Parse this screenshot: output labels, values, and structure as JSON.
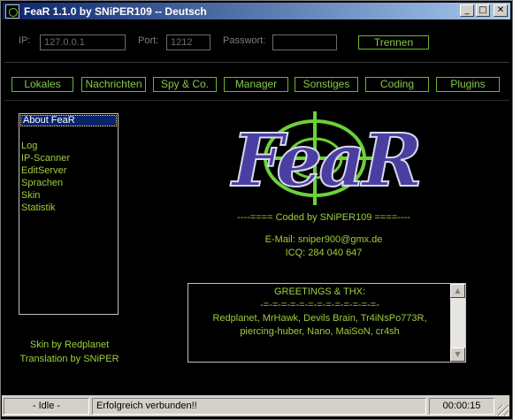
{
  "window": {
    "title": "FeaR 1.1.0 by SNiPER109 -- Deutsch",
    "buttons": {
      "minimize": "_",
      "maximize": "□",
      "close": "✕"
    }
  },
  "connection": {
    "ip_label": "IP:",
    "ip_value": "127.0.0.1",
    "port_label": "Port:",
    "port_value": "1212",
    "password_label": "Passwort:",
    "password_value": "",
    "disconnect_label": "Trennen"
  },
  "tabs": [
    "Lokales",
    "Nachrichten",
    "Spy & Co.",
    "Manager",
    "Sonstiges",
    "Coding",
    "Plugins"
  ],
  "menu_list": {
    "selected": "About FeaR",
    "items": [
      "Log",
      "IP-Scanner",
      "EditServer",
      "Sprachen",
      "Skin",
      "Statistik"
    ]
  },
  "credits": {
    "skin": "Skin by Redplanet",
    "translation": "Translation by SNiPER"
  },
  "about": {
    "logo_text": "FeaR",
    "coded_by": "----==== Coded by SNiPER109 ====----",
    "email": "E-Mail: sniper900@gmx.de",
    "icq": "ICQ: 284 040 647"
  },
  "greetings": {
    "title": "GREETINGS & THX:",
    "divider": "-=-=-=-=-=-=-=-=-=-=-=-=-=-",
    "line1": "Redplanet, MrHawk, Devils Brain, Tr4iNsPo773R,",
    "line2": "piercing-huber, Nano, MaiSoN, cr4sh"
  },
  "statusbar": {
    "state": "- Idle -",
    "message": "Erfolgreich verbunden!!",
    "timer": "00:00:15"
  },
  "colors": {
    "accent_green": "#86c94a",
    "text_green": "#9fcf3c",
    "logo_purple": "#4a3fa0",
    "titlebar": "#0a246a"
  }
}
